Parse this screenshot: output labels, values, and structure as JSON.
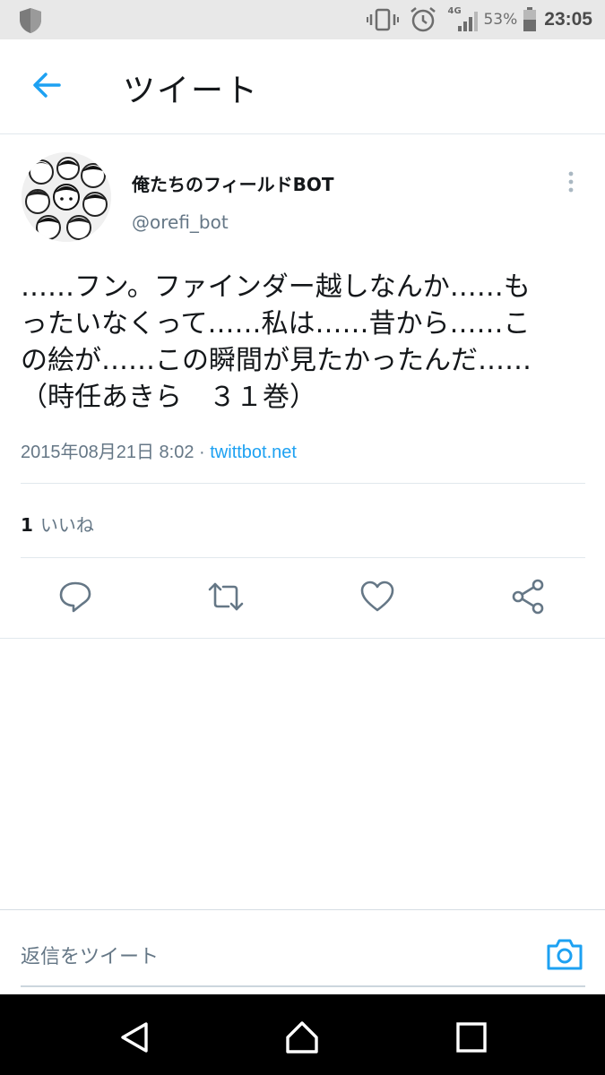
{
  "status_bar": {
    "network": "4G",
    "battery": "53%",
    "time": "23:05",
    "icons": [
      "shield-icon",
      "vibrate-icon",
      "alarm-icon",
      "signal-icon",
      "battery-icon"
    ]
  },
  "header": {
    "title": "ツイート",
    "back_icon": "arrow-left-icon"
  },
  "tweet": {
    "display_name": "俺たちのフィールドBOT",
    "handle": "@orefi_bot",
    "text": "……フン。ファインダー越しなんか……も\nったいなくって……私は……昔から……こ\nの絵が……この瞬間が見たかったんだ……\n（時任あきら　３１巻）",
    "date": "2015年08月21日 8:02 · ",
    "source": "twittbot.net",
    "like_count": "1",
    "like_label": "いいね"
  },
  "actions": [
    "reply-icon",
    "retweet-icon",
    "like-icon",
    "share-icon"
  ],
  "reply_bar": {
    "placeholder": "返信をツイート",
    "camera_icon": "camera-icon"
  },
  "nav_bar": [
    "back-triangle-icon",
    "home-circle-icon",
    "recents-square-icon"
  ],
  "colors": {
    "accent": "#1da1f2",
    "text_primary": "#14171a",
    "text_secondary": "#657786",
    "divider": "#e1e8ed"
  }
}
